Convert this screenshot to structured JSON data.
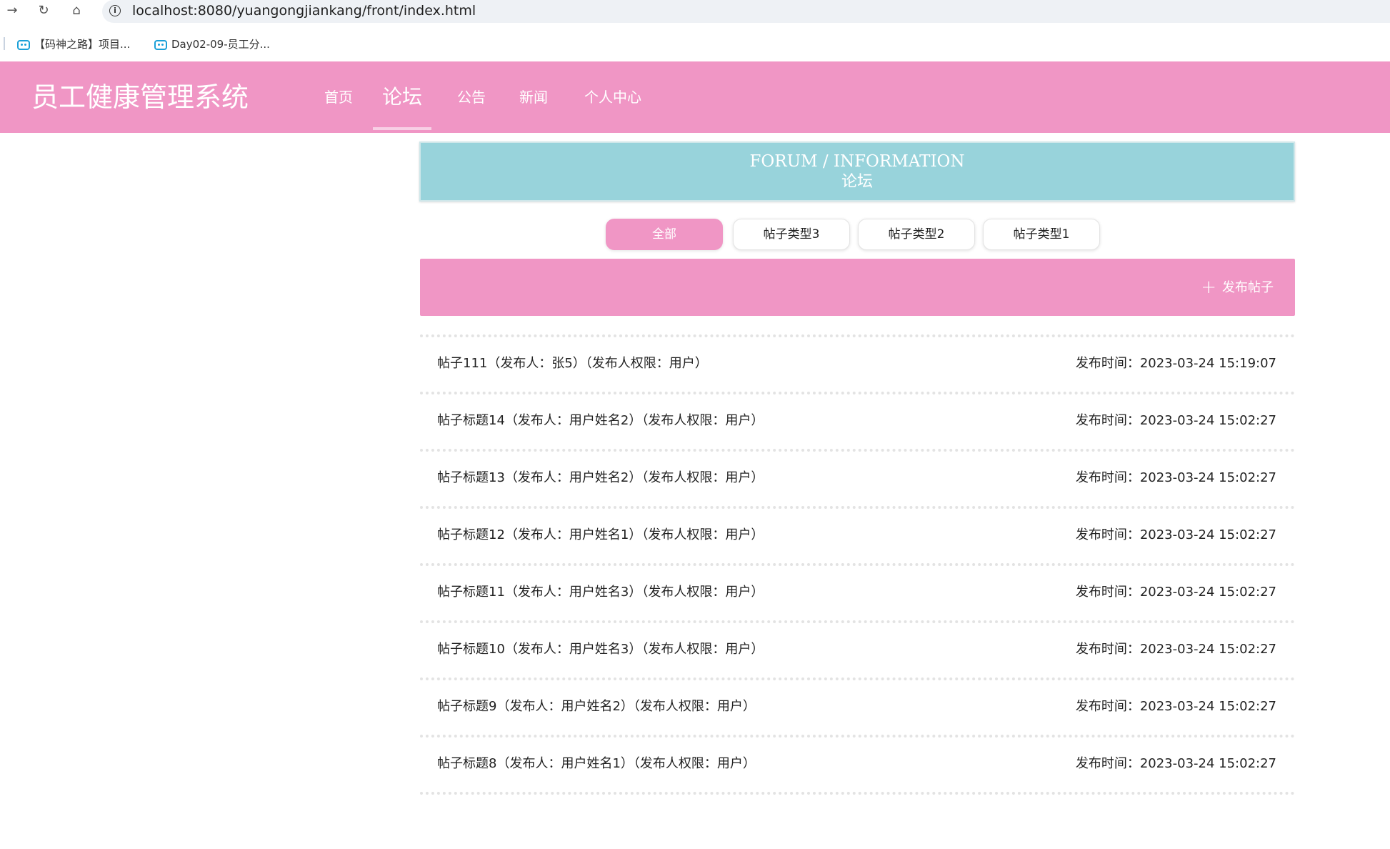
{
  "browser": {
    "url": "localhost:8080/yuangongjiankang/front/index.html",
    "bookmarks": [
      {
        "label": "【码神之路】项目..."
      },
      {
        "label": "Day02-09-员工分..."
      }
    ]
  },
  "header": {
    "title": "员工健康管理系统",
    "nav": [
      {
        "label": "首页"
      },
      {
        "label": "论坛"
      },
      {
        "label": "公告"
      },
      {
        "label": "新闻"
      },
      {
        "label": "个人中心"
      }
    ],
    "active_nav": "论坛",
    "color": "#f096c5"
  },
  "banner": {
    "title_en": "FORUM / INFORMATION",
    "title_cn": "论坛",
    "color": "#98d3db"
  },
  "categories": [
    {
      "label": "全部",
      "active": true
    },
    {
      "label": "帖子类型3"
    },
    {
      "label": "帖子类型2"
    },
    {
      "label": "帖子类型1"
    }
  ],
  "actions": {
    "publish_label": "发布帖子",
    "publish_icon": "plus-icon"
  },
  "posts": [
    {
      "title": "帖子111（发布人：张5）（发布人权限：用户）",
      "time": "发布时间：2023-03-24 15:19:07"
    },
    {
      "title": "帖子标题14（发布人：用户姓名2）（发布人权限：用户）",
      "time": "发布时间：2023-03-24 15:02:27"
    },
    {
      "title": "帖子标题13（发布人：用户姓名2）（发布人权限：用户）",
      "time": "发布时间：2023-03-24 15:02:27"
    },
    {
      "title": "帖子标题12（发布人：用户姓名1）（发布人权限：用户）",
      "time": "发布时间：2023-03-24 15:02:27"
    },
    {
      "title": "帖子标题11（发布人：用户姓名3）（发布人权限：用户）",
      "time": "发布时间：2023-03-24 15:02:27"
    },
    {
      "title": "帖子标题10（发布人：用户姓名3）（发布人权限：用户）",
      "time": "发布时间：2023-03-24 15:02:27"
    },
    {
      "title": "帖子标题9（发布人：用户姓名2）（发布人权限：用户）",
      "time": "发布时间：2023-03-24 15:02:27"
    },
    {
      "title": "帖子标题8（发布人：用户姓名1）（发布人权限：用户）",
      "time": "发布时间：2023-03-24 15:02:27"
    },
    {
      "title": "",
      "time": ""
    }
  ]
}
